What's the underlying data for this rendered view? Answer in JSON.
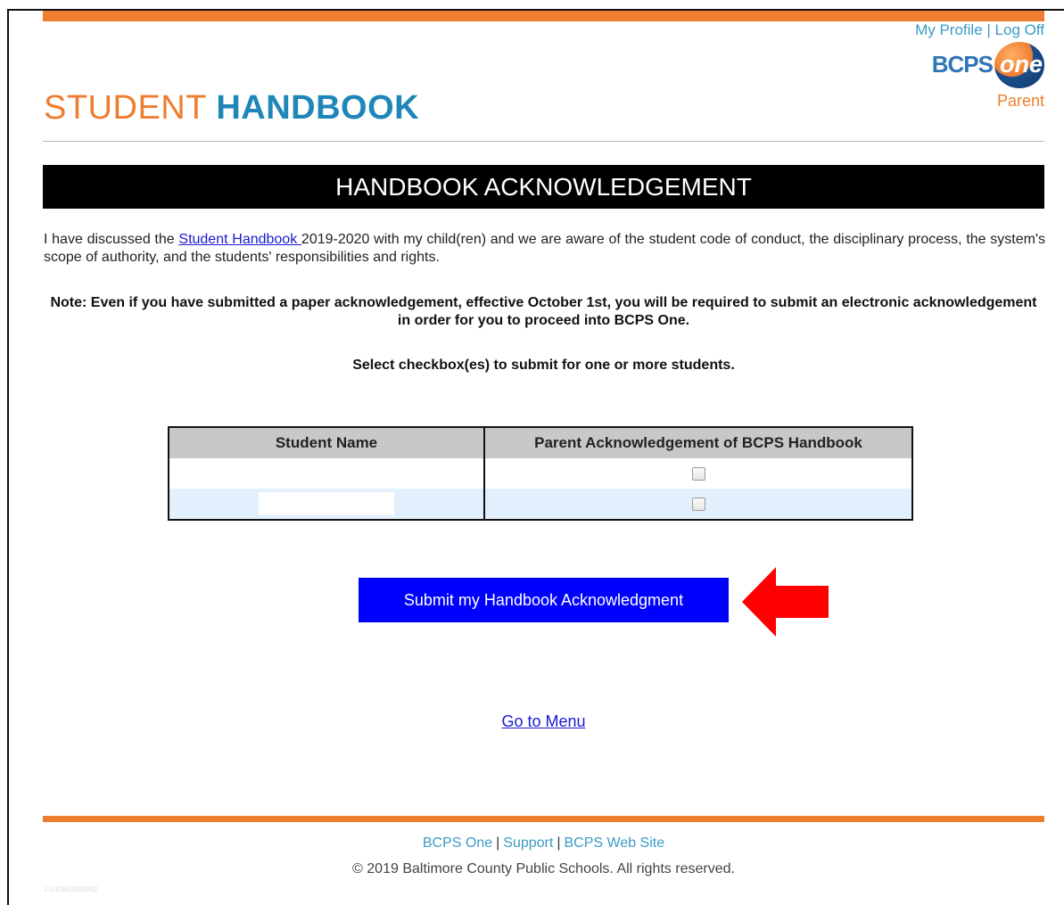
{
  "header": {
    "profile_link": "My Profile",
    "separator": "|",
    "logoff_link": "Log Off",
    "logo_text": "BCPS",
    "logo_one": "one",
    "role": "Parent",
    "title_part1": "STUDENT",
    "title_part2": "HANDBOOK"
  },
  "banner": {
    "title": "HANDBOOK ACKNOWLEDGEMENT"
  },
  "intro": {
    "prefix": "I have discussed the ",
    "link": "Student Handbook ",
    "suffix": "2019-2020 with my child(ren) and we are aware of the student code of conduct, the disciplinary process, the system's scope of authority, and the students' responsibilities and rights."
  },
  "note": "Note: Even if you have submitted a paper acknowledgement, effective October 1st, you will be required to submit an electronic acknowledgement in order for you to proceed into BCPS One.",
  "select_note": "Select checkbox(es) to submit for one or more students.",
  "table": {
    "headers": [
      "Student Name",
      "Parent Acknowledgement of BCPS Handbook"
    ],
    "rows": [
      {
        "name": "",
        "checked": false
      },
      {
        "name": "",
        "checked": false
      }
    ]
  },
  "submit_label": "Submit my Handbook Acknowledgment",
  "menu_link": "Go to Menu",
  "footer": {
    "links": [
      "BCPS One",
      "Support",
      "BCPS Web Site"
    ],
    "separator": "|",
    "copyright": "© 2019 Baltimore County Public Schools. All rights reserved.",
    "version": "1-130643392802"
  },
  "colors": {
    "accent": "#ee7d2f",
    "brand_blue": "#1f86b8",
    "button": "#0000ff",
    "arrow": "#ff0000"
  }
}
